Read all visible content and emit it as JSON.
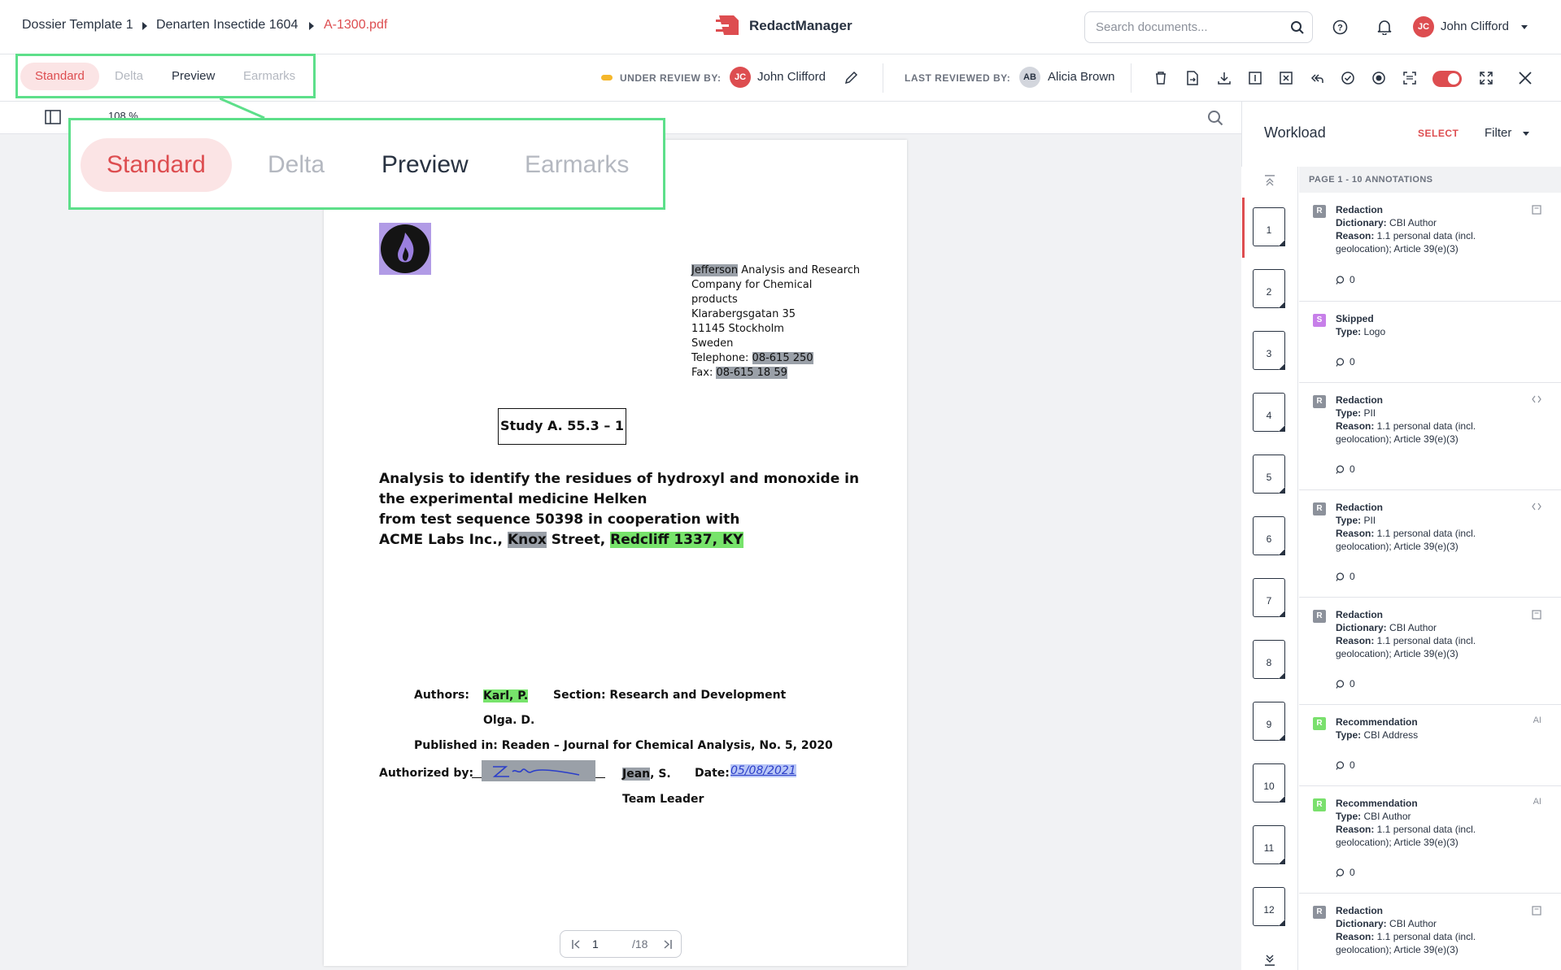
{
  "breadcrumb": {
    "template": "Dossier Template 1",
    "dossier": "Denarten Insectide 1604",
    "file": "A-1300.pdf"
  },
  "app": {
    "name": "RedactManager"
  },
  "search": {
    "placeholder": "Search documents..."
  },
  "user": {
    "initials": "JC",
    "name": "John Clifford"
  },
  "view_tabs": [
    {
      "label": "Standard",
      "state": "active"
    },
    {
      "label": "Delta",
      "state": "disabled"
    },
    {
      "label": "Preview",
      "state": "normal"
    },
    {
      "label": "Earmarks",
      "state": "disabled"
    }
  ],
  "review": {
    "under_review_label": "UNDER REVIEW BY:",
    "reviewer_initials": "JC",
    "reviewer_name": "John Clifford",
    "last_reviewed_label": "LAST REVIEWED BY:",
    "last_initials": "AB",
    "last_name": "Alicia Brown"
  },
  "viewer": {
    "zoom": "108 %",
    "current_page": "1",
    "total_pages": "/18"
  },
  "document": {
    "address": [
      {
        "hl": "Jefferson",
        "rest": " Analysis and Research"
      },
      {
        "hl": "",
        "rest": "Company for Chemical"
      },
      {
        "hl": "",
        "rest": "products"
      },
      {
        "hl": "",
        "rest": "Klarabergsgatan 35"
      },
      {
        "hl": "",
        "rest": "11145 Stockholm"
      },
      {
        "hl": "",
        "rest": "Sweden"
      }
    ],
    "telephone_label": "Telephone: ",
    "telephone": "08-615 250",
    "fax_label": "Fax: ",
    "fax": "08-615 18 59",
    "study": "Study A. 55.3 – 1",
    "title_lines": [
      "Analysis to identify the residues of hydroxyl and monoxide in",
      "the experimental medicine Helken",
      "from test sequence 50398 in cooperation with"
    ],
    "title_last_prefix": "ACME Labs Inc., ",
    "title_last_redacted": "Knox",
    "title_last_mid": " Street, ",
    "title_last_green": "Redcliff 1337, KY",
    "authors_label": "Authors:",
    "author1": "Karl, P.",
    "section": "Section: Research and Development",
    "author2": "Olga. D.",
    "published": "Published in: Readen – Journal for Chemical Analysis, No. 5, 2020",
    "authorized_label": "Authorized by:",
    "signer_hl": "Jean",
    "signer_rest": ", S.",
    "date_label": "Date:",
    "date_value": "05/08/2021",
    "signer_role": "Team Leader"
  },
  "workload": {
    "title": "Workload",
    "select": "SELECT",
    "filter": "Filter",
    "page_header": "PAGE 1 - 10 ANNOTATIONS",
    "pages": [
      "1",
      "2",
      "3",
      "4",
      "5",
      "6",
      "7",
      "8",
      "9",
      "10",
      "11",
      "12"
    ],
    "annotations": [
      {
        "badge": "R",
        "color": "#8c919b",
        "title": "Redaction",
        "k1": "Dictionary:",
        "v1": " CBI Author",
        "k2": "Reason:",
        "v2": " 1.1 personal data (incl. geolocation); Article 39(e)(3)",
        "comments": "0",
        "right": ""
      },
      {
        "badge": "S",
        "color": "#c77fe9",
        "title": "Skipped",
        "k1": "Type:",
        "v1": " Logo",
        "k2": "",
        "v2": "",
        "comments": "0",
        "right": ""
      },
      {
        "badge": "R",
        "color": "#8c919b",
        "title": "Redaction",
        "k1": "Type:",
        "v1": " PII",
        "k2": "Reason:",
        "v2": " 1.1 personal data (incl. geolocation); Article 39(e)(3)",
        "comments": "0",
        "right": ""
      },
      {
        "badge": "R",
        "color": "#8c919b",
        "title": "Redaction",
        "k1": "Type:",
        "v1": " PII",
        "k2": "Reason:",
        "v2": " 1.1 personal data (incl. geolocation); Article 39(e)(3)",
        "comments": "0",
        "right": ""
      },
      {
        "badge": "R",
        "color": "#8c919b",
        "title": "Redaction",
        "k1": "Dictionary:",
        "v1": " CBI Author",
        "k2": "Reason:",
        "v2": " 1.1 personal data (incl. geolocation); Article 39(e)(3)",
        "comments": "0",
        "right": ""
      },
      {
        "badge": "R",
        "color": "#7ae06d",
        "title": "Recommendation",
        "k1": "Type:",
        "v1": " CBI Address",
        "k2": "",
        "v2": "",
        "comments": "0",
        "right": "AI"
      },
      {
        "badge": "R",
        "color": "#7ae06d",
        "title": "Recommendation",
        "k1": "Type:",
        "v1": " CBI Author",
        "k2": "Reason:",
        "v2": " 1.1 personal data (incl. geolocation); Article 39(e)(3)",
        "comments": "0",
        "right": "AI"
      },
      {
        "badge": "R",
        "color": "#8c919b",
        "title": "Redaction",
        "k1": "Dictionary:",
        "v1": " CBI Author",
        "k2": "Reason:",
        "v2": " 1.1 personal data (incl. geolocation); Article 39(e)(3)",
        "comments": "",
        "right": ""
      }
    ]
  },
  "colors": {
    "accent": "#dd4d50",
    "callout": "#5ddf8a",
    "redact_grey": "#9aa0a8",
    "highlight_green": "#77e36b"
  }
}
